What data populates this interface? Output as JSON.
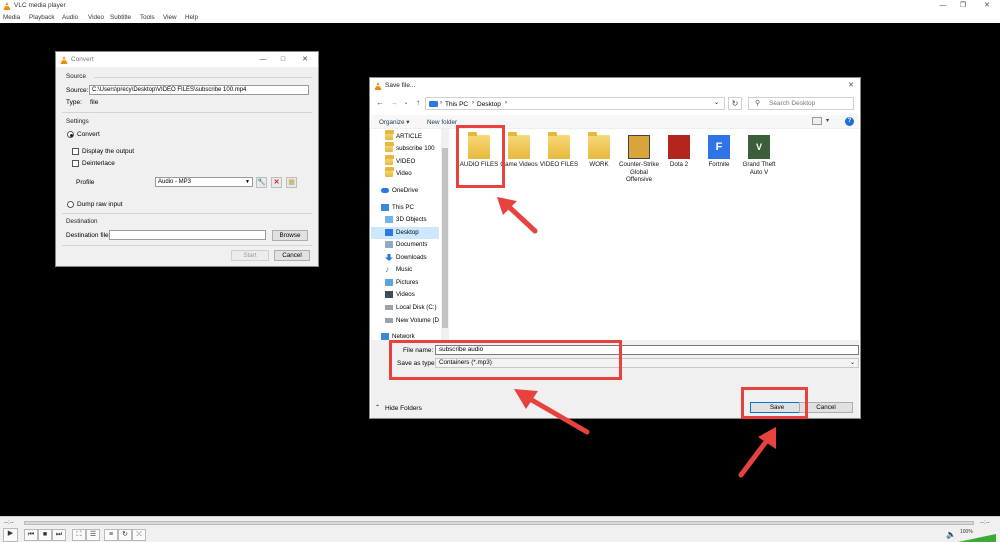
{
  "vlc": {
    "title": "VLC media player",
    "menu": [
      "Media",
      "Playback",
      "Audio",
      "Video",
      "Subtitle",
      "Tools",
      "View",
      "Help"
    ],
    "time_elapsed": "--:--",
    "time_total": "--:--",
    "volume": "100%"
  },
  "convert": {
    "title": "Convert",
    "source_section": "Source",
    "source_label": "Source:",
    "source_value": "C:\\Users\\precy\\Desktop\\VIDEO FILES\\subscribe 100.mp4",
    "type_label": "Type:",
    "type_value": "file",
    "settings_section": "Settings",
    "convert_option": "Convert",
    "display_output": "Display the output",
    "deinterlace": "Deinterlace",
    "profile_label": "Profile",
    "profile_value": "Audio - MP3",
    "dump_raw": "Dump raw input",
    "destination_section": "Destination",
    "destination_label": "Destination file:",
    "destination_value": "",
    "browse_label": "Browse",
    "start_label": "Start",
    "cancel_label": "Cancel"
  },
  "save": {
    "title": "Save file...",
    "breadcrumb": [
      "This PC",
      "Desktop"
    ],
    "search_placeholder": "Search Desktop",
    "organize_label": "Organize ▾",
    "new_folder_label": "New folder",
    "nav_items": [
      {
        "label": "ARTICLE",
        "type": "folder"
      },
      {
        "label": "subscribe 100",
        "type": "folder"
      },
      {
        "label": "VIDEO",
        "type": "folder"
      },
      {
        "label": "Video",
        "type": "folder"
      },
      {
        "label": "OneDrive",
        "type": "cloud"
      },
      {
        "label": "This PC",
        "type": "pc"
      },
      {
        "label": "3D Objects",
        "type": "cube"
      },
      {
        "label": "Desktop",
        "type": "desktop"
      },
      {
        "label": "Documents",
        "type": "doc"
      },
      {
        "label": "Downloads",
        "type": "download"
      },
      {
        "label": "Music",
        "type": "music"
      },
      {
        "label": "Pictures",
        "type": "picture"
      },
      {
        "label": "Videos",
        "type": "video"
      },
      {
        "label": "Local Disk (C:)",
        "type": "disk"
      },
      {
        "label": "New Volume (D:",
        "type": "disk"
      },
      {
        "label": "Network",
        "type": "network"
      }
    ],
    "files": [
      {
        "label": "AUDIO FILES",
        "kind": "folder"
      },
      {
        "label": "Game Videos",
        "kind": "folder"
      },
      {
        "label": "VIDEO FILES",
        "kind": "folder"
      },
      {
        "label": "WORK",
        "kind": "folder"
      },
      {
        "label": "Counter-Strike Global Offensive",
        "kind": "csgo"
      },
      {
        "label": "Dota 2",
        "kind": "dota"
      },
      {
        "label": "Fortnite",
        "kind": "fortnite"
      },
      {
        "label": "Grand Theft Auto V",
        "kind": "gta"
      }
    ],
    "file_name_label": "File name:",
    "file_name_value": "subscribe audio",
    "save_as_label": "Save as type:",
    "save_as_value": "Containers (*.mp3)",
    "hide_folders_label": "Hide Folders",
    "save_label": "Save",
    "cancel_label": "Cancel"
  },
  "colors": {
    "highlight": "#e8423f",
    "selected": "#cce8ff",
    "folder": "#f2c94c"
  }
}
